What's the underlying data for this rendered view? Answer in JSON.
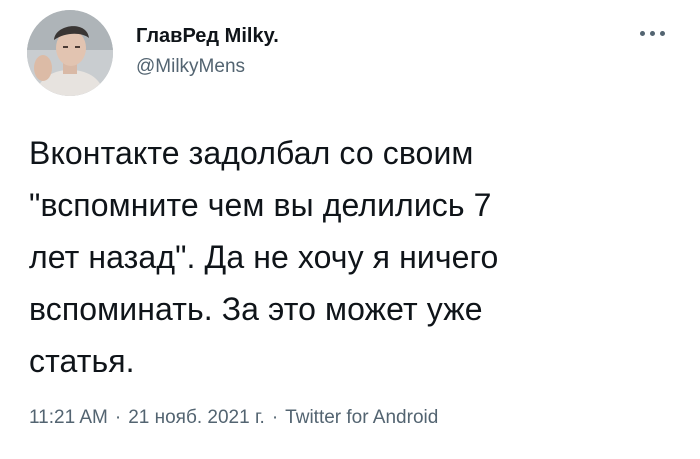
{
  "author": {
    "display_name": "ГлавРед Milky.",
    "handle": "@MilkyMens",
    "avatar_icon": "user-photo-avatar"
  },
  "menu": {
    "icon": "more-horizontal-icon"
  },
  "tweet": {
    "text_lines": [
      "Вконтакте задолбал со своим",
      "\"вспомните чем вы делились 7",
      "лет назад\". Да не хочу я ничего",
      "вспоминать. За это может уже",
      "статья."
    ]
  },
  "meta": {
    "time": "11:21 AM",
    "separator": "·",
    "date": "21 нояб. 2021 г.",
    "source": "Twitter for Android"
  },
  "colors": {
    "text_primary": "#0f1419",
    "text_secondary": "#536471",
    "background": "#ffffff"
  }
}
